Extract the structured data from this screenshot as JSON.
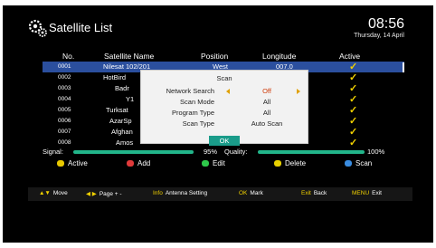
{
  "header": {
    "icon": "gear-icon",
    "title": "Satellite List",
    "time": "08:56",
    "date": "Thursday, 14 April"
  },
  "table": {
    "columns": [
      "No.",
      "Satellite Name",
      "Position",
      "Longitude",
      "Active"
    ],
    "rows": [
      {
        "no": "0001",
        "name": "Nilesat 102/201",
        "position": "West",
        "longitude": "007.0",
        "active": "✓"
      },
      {
        "no": "0002",
        "name": "HotBird",
        "position": "",
        "longitude": "",
        "active": "✓"
      },
      {
        "no": "0003",
        "name": "Badr",
        "position": "",
        "longitude": "",
        "active": "✓"
      },
      {
        "no": "0004",
        "name": "Y1",
        "position": "",
        "longitude": "",
        "active": "✓"
      },
      {
        "no": "0005",
        "name": "Turksat",
        "position": "",
        "longitude": "",
        "active": "✓"
      },
      {
        "no": "0006",
        "name": "AzarSp",
        "position": "",
        "longitude": "",
        "active": "✓"
      },
      {
        "no": "0007",
        "name": "Afghan",
        "position": "",
        "longitude": "",
        "active": "✓"
      },
      {
        "no": "0008",
        "name": "Amos",
        "position": "",
        "longitude": "",
        "active": "✓"
      }
    ]
  },
  "signal": {
    "signal_label": "Signal:",
    "signal_pct": "95%",
    "quality_label": "Quality:",
    "quality_pct": "100%",
    "signal_level": 0.95,
    "quality_level": 1.0,
    "bar_color": "#22b58a"
  },
  "legend": [
    {
      "label": "Active",
      "color": "#e8c800",
      "icon": "yellow-key-icon"
    },
    {
      "label": "Add",
      "color": "#e03a3a",
      "icon": "red-key-icon"
    },
    {
      "label": "Edit",
      "color": "#2ec84a",
      "icon": "green-key-icon"
    },
    {
      "label": "Delete",
      "color": "#e8d000",
      "icon": "yellow-key-icon"
    },
    {
      "label": "Scan",
      "color": "#3a8ce0",
      "icon": "blue-key-icon"
    }
  ],
  "hints": [
    {
      "key": "▲▼",
      "label": "Move"
    },
    {
      "key": "◀ ▶",
      "label": "Page + -"
    },
    {
      "key": "Info",
      "label": "Antenna Setting"
    },
    {
      "key": "OK",
      "label": "Mark"
    },
    {
      "key": "Exit",
      "label": "Back"
    },
    {
      "key": "MENU",
      "label": "Exit"
    }
  ],
  "dialog": {
    "title": "Scan",
    "network_search_label": "Network Search",
    "network_search_value": "Off",
    "scan_mode_label": "Scan Mode",
    "scan_mode_value": "All",
    "program_type_label": "Program Type",
    "program_type_value": "All",
    "scan_type_label": "Scan Type",
    "scan_type_value": "Auto Scan",
    "ok_label": "OK"
  }
}
